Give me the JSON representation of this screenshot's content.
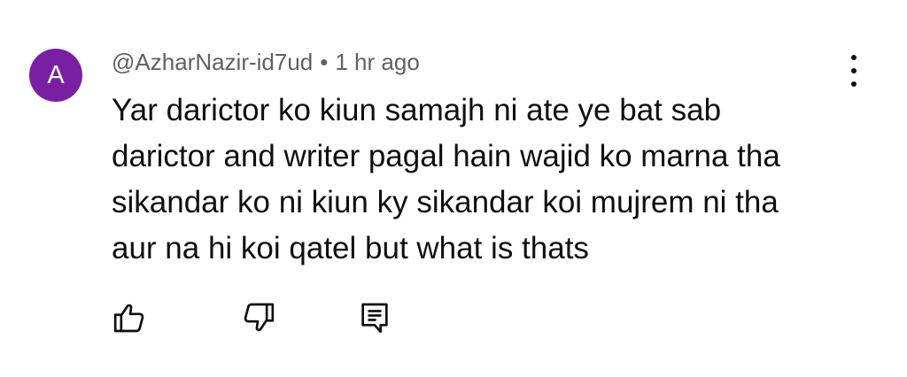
{
  "comment": {
    "avatar_letter": "A",
    "avatar_color": "#7b1fa2",
    "author": "@AzharNazir-id7ud",
    "separator": "•",
    "time": "1 hr ago",
    "text": "Yar darictor ko kiun samajh ni ate ye bat sab darictor and writer pagal hain wajid ko marna tha sikandar ko ni kiun ky sikandar koi mujrem ni tha aur na hi koi qatel but what is thats"
  },
  "actions": {
    "like_icon": "thumbs-up-icon",
    "dislike_icon": "thumbs-down-icon",
    "reply_icon": "reply-comment-icon",
    "more_icon": "more-vertical-icon"
  }
}
